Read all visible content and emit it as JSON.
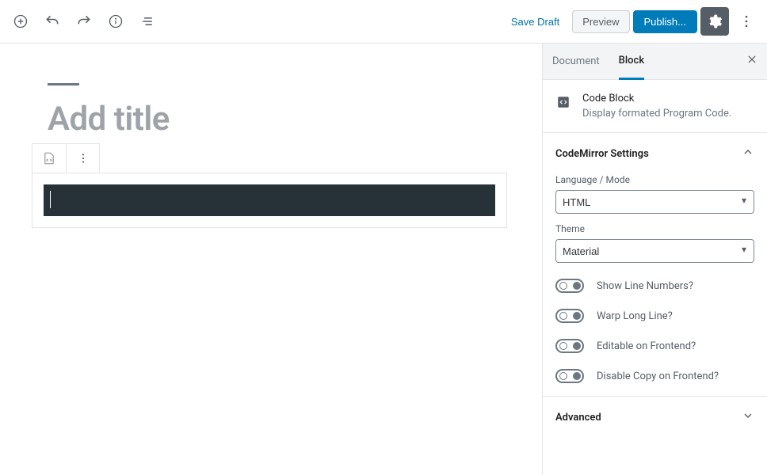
{
  "topbar": {
    "save_draft": "Save Draft",
    "preview": "Preview",
    "publish": "Publish..."
  },
  "editor": {
    "title_placeholder": "Add title"
  },
  "sidebar": {
    "tabs": {
      "document": "Document",
      "block": "Block"
    },
    "block_header": {
      "title": "Code Block",
      "desc": "Display formated Program Code."
    },
    "codemirror": {
      "panel_title": "CodeMirror Settings",
      "language_label": "Language / Mode",
      "language_value": "HTML",
      "theme_label": "Theme",
      "theme_value": "Material",
      "toggles": {
        "line_numbers": "Show Line Numbers?",
        "wrap_long": "Warp Long Line?",
        "editable_frontend": "Editable on Frontend?",
        "disable_copy": "Disable Copy on Frontend?"
      }
    },
    "advanced": {
      "panel_title": "Advanced"
    }
  }
}
